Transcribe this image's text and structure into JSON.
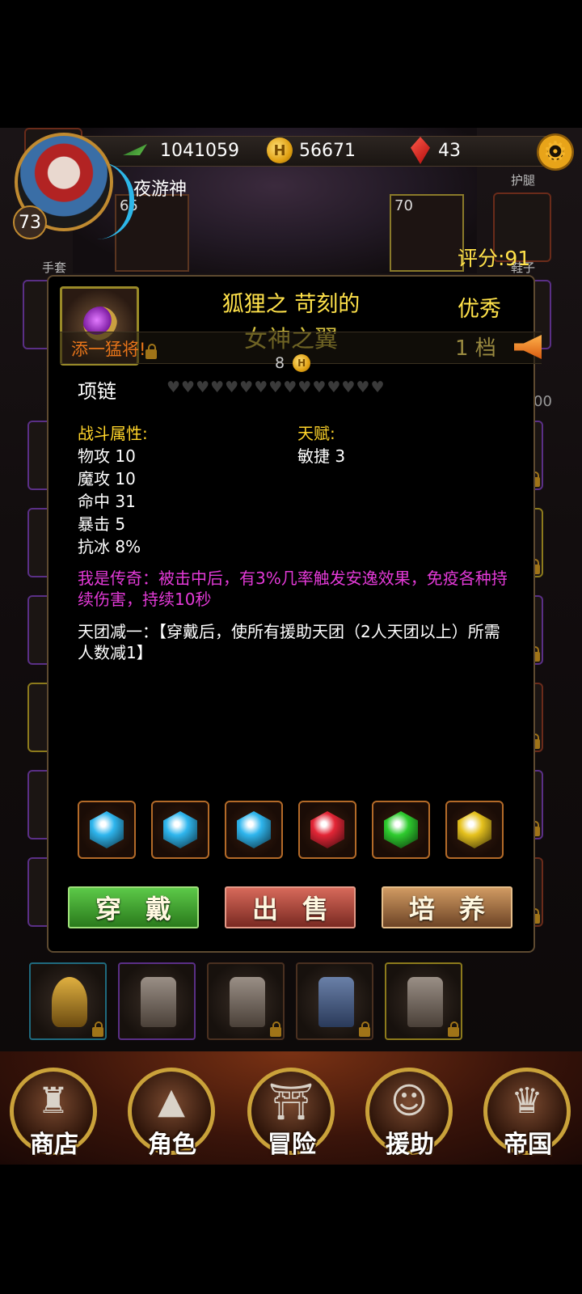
{
  "header": {
    "power": "1041059",
    "gold": "56671",
    "gems": "43",
    "player_name": "夜游神",
    "player_level": "73",
    "score": "评分:91",
    "hero_levels": [
      "65",
      "70"
    ],
    "side_labels": {
      "gloves": "手套",
      "leggings": "护腿",
      "shoes": "鞋子"
    },
    "side_count_fragment": "00"
  },
  "icons": {
    "power": "wing-icon",
    "gold": "coin-icon",
    "gems": "red-gem-icon",
    "settings": "gear-icon"
  },
  "item": {
    "title_line1": "狐狸之  苛刻的",
    "title_line2": "女神之翼",
    "quality": "优秀",
    "banner": "添一猛将!",
    "tier": "1  档",
    "price": "8",
    "type": "项链",
    "hearts": "♥♥♥♥♥♥♥♥♥♥♥♥♥♥♥",
    "combat_header": "战斗属性:",
    "combat_stats": [
      "物攻 10",
      "魔攻 10",
      "命中 31",
      "暴击 5",
      "抗冰 8%"
    ],
    "talent_header": "天赋:",
    "talents": [
      "敏捷 3"
    ],
    "legend_effect": "我是传奇：被击中后，有3%几率触发安逸效果，免疫各种持续伤害，持续10秒",
    "set_effect": "天团减一：【穿戴后，使所有援助天团（2人天团以上）所需人数减1】",
    "gem_slots": [
      {
        "name": "blue-gem-icon",
        "color": "#2fb6ee"
      },
      {
        "name": "blue-gem-icon",
        "color": "#2fb6ee"
      },
      {
        "name": "blue-gem-icon",
        "color": "#2fb6ee"
      },
      {
        "name": "red-gem-icon",
        "color": "#e32636"
      },
      {
        "name": "green-gem-icon",
        "color": "#2ecc2e"
      },
      {
        "name": "yellow-gem-icon",
        "color": "#e6c21e"
      }
    ],
    "buttons": {
      "equip": "穿戴",
      "sell": "出售",
      "train": "培养"
    }
  },
  "bag": [
    "helmet-icon",
    "armor-icon",
    "armor-icon",
    "robe-icon",
    "armor-icon"
  ],
  "nav": [
    {
      "label": "商店",
      "icon": "castle-icon"
    },
    {
      "label": "角色",
      "icon": "hood-icon"
    },
    {
      "label": "冒险",
      "icon": "gate-icon"
    },
    {
      "label": "援助",
      "icon": "girl-portrait-icon"
    },
    {
      "label": "帝国",
      "icon": "crown-icon"
    }
  ],
  "colors": {
    "title": "#ffe24a",
    "legend": "#e43ad8",
    "banner": "#e8751a",
    "section_header": "#ffd42a"
  }
}
